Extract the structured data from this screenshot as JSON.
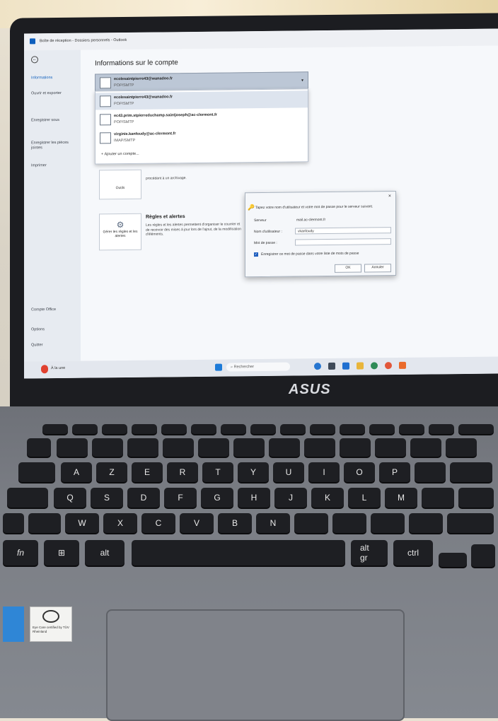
{
  "window_title": "Boîte de réception - Dossiers personnels - Outlook",
  "page_title": "Informations sur le compte",
  "sidebar": {
    "items": [
      {
        "label": "Informations"
      },
      {
        "label": "Ouvrir et exporter"
      },
      {
        "label": "Enregistrer sous"
      },
      {
        "label": "Enregistrer les pièces jointes"
      },
      {
        "label": "Imprimer"
      },
      {
        "label": "Compte Office"
      },
      {
        "label": "Options"
      },
      {
        "label": "Quitter"
      }
    ]
  },
  "account_select": {
    "email": "ecolesaintpierre43@wanadoo.fr",
    "type": "POP/SMTP"
  },
  "accounts": [
    {
      "email": "ecolesaintpierre43@wanadoo.fr",
      "type": "POP/SMTP"
    },
    {
      "email": "ec43.prim.stpierreduchamp.saintjoseph@ac-clermont.fr",
      "type": "POP/SMTP"
    },
    {
      "email": "virginie.kanfoudy@ac-clermont.fr",
      "type": "IMAP/SMTP"
    }
  ],
  "add_account_label": "Ajouter un compte...",
  "tools": {
    "label": "Outils",
    "text": "procédant à un archivage."
  },
  "rules": {
    "tile_label": "Gérer les règles et les alertes",
    "title": "Règles et alertes",
    "text": "Les règles et les alertes permettent d'organiser le courrier et de recevoir des mises à jour lors de l'ajout, de la modification d'éléments."
  },
  "dialog": {
    "message": "Tapez votre nom d'utilisateur et votre mot de passe pour le serveur suivant.",
    "server_label": "Serveur",
    "server_value": "mail.ac-clermont.fr",
    "user_label": "Nom d'utilisateur :",
    "user_value": "vkanfoudy",
    "password_label": "Mot de passe :",
    "password_value": "",
    "remember_label": "Enregistrer ce mot de passe dans votre liste de mots de passe",
    "remember_checked": true,
    "ok_label": "OK",
    "cancel_label": "Annuler"
  },
  "taskbar": {
    "search_placeholder": "Rechercher",
    "weather": "À la une"
  },
  "brand": "ASUS",
  "keys": {
    "row1": [
      "A",
      "Z",
      "E",
      "R",
      "T",
      "Y",
      "U",
      "I",
      "O",
      "P"
    ],
    "row2": [
      "Q",
      "S",
      "D",
      "F",
      "G",
      "H",
      "J",
      "K",
      "L",
      "M"
    ],
    "row3": [
      "W",
      "X",
      "C",
      "V",
      "B",
      "N"
    ],
    "alt": "alt",
    "alt_gr": "alt gr",
    "ctrl": "ctrl",
    "fn": "fn"
  },
  "sticker_text": "Eye Care certified by TÜV Rheinland",
  "colors": {
    "accent": "#0f5fbd",
    "keys": "#1e1f23",
    "chassis": "#7a7d84"
  }
}
